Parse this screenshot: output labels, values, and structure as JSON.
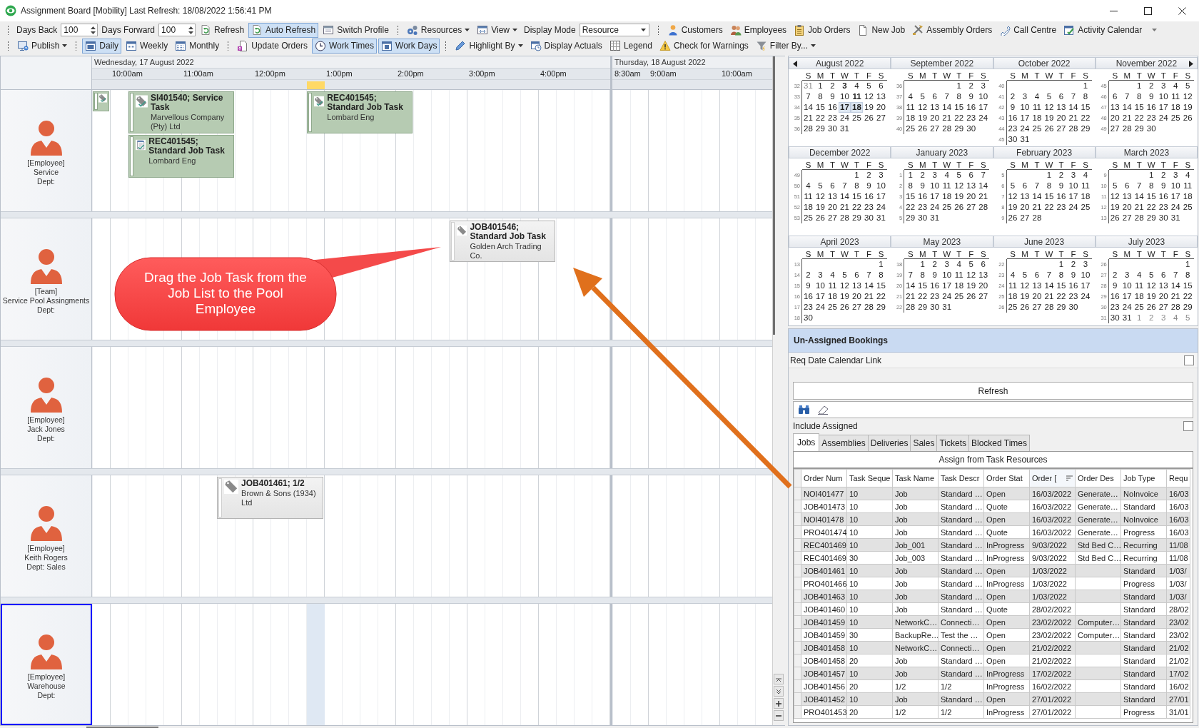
{
  "window": {
    "title": "Assignment Board [Mobility] Last Refresh: 18/08/2022 1:56:41 PM"
  },
  "toolbar": {
    "rows": [
      {
        "items": [
          {
            "kind": "grip"
          },
          {
            "kind": "label",
            "text": "Days Back"
          },
          {
            "kind": "spin",
            "value": "100"
          },
          {
            "kind": "label",
            "text": "Days Forward"
          },
          {
            "kind": "spin",
            "value": "100"
          },
          {
            "kind": "button",
            "label": "Refresh",
            "pressed": false
          },
          {
            "kind": "button",
            "label": "Auto Refresh",
            "pressed": true
          },
          {
            "kind": "button",
            "label": "Switch Profile",
            "pressed": false
          },
          {
            "kind": "grip"
          },
          {
            "kind": "menu",
            "label": "Resources",
            "pressed": false
          },
          {
            "kind": "menu",
            "label": "View",
            "pressed": false
          },
          {
            "kind": "label",
            "text": "Display Mode"
          },
          {
            "kind": "combo",
            "value": "Resource"
          },
          {
            "kind": "grip"
          },
          {
            "kind": "button",
            "label": "Customers",
            "pressed": false
          },
          {
            "kind": "button",
            "label": "Employees",
            "pressed": false
          },
          {
            "kind": "button",
            "label": "Job Orders",
            "pressed": false
          },
          {
            "kind": "button",
            "label": "New Job",
            "pressed": false
          },
          {
            "kind": "button",
            "label": "Assembly Orders",
            "pressed": false
          },
          {
            "kind": "button",
            "label": "Call Centre",
            "pressed": false
          },
          {
            "kind": "button",
            "label": "Activity Calendar",
            "pressed": false
          },
          {
            "kind": "overflow"
          }
        ]
      },
      {
        "items": [
          {
            "kind": "grip"
          },
          {
            "kind": "menu",
            "label": "Publish",
            "pressed": false
          },
          {
            "kind": "grip"
          },
          {
            "kind": "button",
            "label": "Daily",
            "pressed": true
          },
          {
            "kind": "button",
            "label": "Weekly",
            "pressed": false
          },
          {
            "kind": "button",
            "label": "Monthly",
            "pressed": false
          },
          {
            "kind": "grip"
          },
          {
            "kind": "button",
            "label": "Update Orders",
            "pressed": false
          },
          {
            "kind": "button",
            "label": "Work Times",
            "pressed": true
          },
          {
            "kind": "button",
            "label": "Work Days",
            "pressed": true
          },
          {
            "kind": "grip"
          },
          {
            "kind": "menu",
            "label": "Highlight By",
            "pressed": false
          },
          {
            "kind": "button",
            "label": "Display Actuals",
            "pressed": false
          },
          {
            "kind": "button",
            "label": "Legend",
            "pressed": false
          },
          {
            "kind": "button",
            "label": "Check for Warnings",
            "pressed": false
          },
          {
            "kind": "menu",
            "label": "Filter By...",
            "pressed": false
          }
        ]
      }
    ]
  },
  "schedule": {
    "days": [
      {
        "label": "Wednesday, 17 August 2022",
        "hours": [
          "10:00am",
          "11:00am",
          "12:00pm",
          "1:00pm",
          "2:00pm",
          "3:00pm",
          "4:00pm"
        ]
      },
      {
        "label": "Thursday, 18 August 2022",
        "hours": [
          "8:30am",
          "9:00am",
          "10:00am"
        ]
      }
    ],
    "resources": [
      {
        "type": "[Employee]",
        "name": "Service",
        "dept": "Dept:",
        "selected": false,
        "bookings": [
          {
            "assigned": true
          },
          {
            "title": "SI401540; Service Task",
            "customer": "Marvellous Company (Pty) Ltd",
            "assigned": true
          },
          {
            "title": "REC401545; Standard Job Task",
            "customer": "Lombard Eng",
            "assigned": true
          },
          {
            "title": "REC401545; Standard Job Task",
            "customer": "Lombard Eng",
            "assigned": true
          }
        ]
      },
      {
        "type": "[Team]",
        "name": "Service Pool Assingments",
        "dept": "Dept:",
        "selected": false,
        "bookings": [
          {
            "title": "JOB401546; Standard Job Task",
            "customer": "Golden Arch Trading Co.",
            "assigned": false
          }
        ]
      },
      {
        "type": "[Employee]",
        "name": "Jack Jones",
        "dept": "Dept:",
        "selected": false
      },
      {
        "type": "[Employee]",
        "name": "Keith Rogers",
        "dept": "Dept: Sales",
        "selected": false,
        "bookings": [
          {
            "title": "JOB401461; 1/2",
            "customer": "Brown & Sons (1934) Ltd",
            "assigned": false
          }
        ]
      },
      {
        "type": "[Employee]",
        "name": "Warehouse",
        "dept": "Dept:",
        "selected": true
      }
    ]
  },
  "calendar": {
    "months": [
      {
        "title": "August 2022",
        "weekdays": [
          "S",
          "M",
          "T",
          "W",
          "T",
          "F",
          "S"
        ],
        "weeks": [
          {
            "no": "32",
            "days": [
              {
                "day": "31",
                "other_month": true,
                "bold": false,
                "selected": false
              },
              "1",
              "2",
              {
                "day": "3",
                "other_month": false,
                "bold": true,
                "selected": false
              },
              "4",
              "5",
              "6"
            ]
          },
          {
            "no": "33",
            "days": [
              "7",
              "8",
              "9",
              "10",
              {
                "day": "11",
                "other_month": false,
                "bold": true,
                "selected": false
              },
              "12",
              "13"
            ]
          },
          {
            "no": "34",
            "days": [
              "14",
              "15",
              "16",
              {
                "day": "17",
                "other_month": false,
                "bold": true,
                "selected": true
              },
              {
                "day": "18",
                "other_month": false,
                "bold": true,
                "selected": true
              },
              "19",
              "20"
            ]
          },
          {
            "no": "35",
            "days": [
              "21",
              "22",
              "23",
              "24",
              "25",
              "26",
              "27"
            ]
          },
          {
            "no": "36",
            "days": [
              "28",
              "29",
              "30",
              "31"
            ]
          }
        ]
      },
      {
        "title": "September 2022",
        "weekdays": [
          "S",
          "M",
          "T",
          "W",
          "T",
          "F",
          "S"
        ],
        "weeks": [
          {
            "no": "36",
            "days": [
              "1",
              "2",
              "3"
            ]
          },
          {
            "no": "37",
            "days": [
              "4",
              "5",
              "6",
              "7",
              "8",
              "9",
              "10"
            ]
          },
          {
            "no": "38",
            "days": [
              "11",
              "12",
              "13",
              "14",
              "15",
              "16",
              "17"
            ]
          },
          {
            "no": "39",
            "days": [
              "18",
              "19",
              "20",
              "21",
              "22",
              "23",
              "24"
            ]
          },
          {
            "no": "40",
            "days": [
              "25",
              "26",
              "27",
              "28",
              "29",
              "30"
            ]
          }
        ]
      },
      {
        "title": "October 2022",
        "weekdays": [
          "S",
          "M",
          "T",
          "W",
          "T",
          "F",
          "S"
        ],
        "weeks": [
          {
            "no": "40",
            "days": [
              "1"
            ]
          },
          {
            "no": "41",
            "days": [
              "2",
              "3",
              "4",
              "5",
              "6",
              "7",
              "8"
            ]
          },
          {
            "no": "42",
            "days": [
              "9",
              "10",
              "11",
              "12",
              "13",
              "14",
              "15"
            ]
          },
          {
            "no": "43",
            "days": [
              "16",
              "17",
              "18",
              "19",
              "20",
              "21",
              "22"
            ]
          },
          {
            "no": "44",
            "days": [
              "23",
              "24",
              "25",
              "26",
              "27",
              "28",
              "29"
            ]
          },
          {
            "no": "45",
            "days": [
              "30",
              "31"
            ]
          }
        ]
      },
      {
        "title": "November 2022",
        "weekdays": [
          "S",
          "M",
          "T",
          "W",
          "T",
          "F",
          "S"
        ],
        "weeks": [
          {
            "no": "45",
            "days": [
              "1",
              "2",
              "3",
              "4",
              "5"
            ]
          },
          {
            "no": "46",
            "days": [
              "6",
              "7",
              "8",
              "9",
              "10",
              "11",
              "12"
            ]
          },
          {
            "no": "47",
            "days": [
              "13",
              "14",
              "15",
              "16",
              "17",
              "18",
              "19"
            ]
          },
          {
            "no": "48",
            "days": [
              "20",
              "21",
              "22",
              "23",
              "24",
              "25",
              "26"
            ]
          },
          {
            "no": "49",
            "days": [
              "27",
              "28",
              "29",
              "30"
            ]
          }
        ]
      },
      {
        "title": "December 2022",
        "weekdays": [
          "S",
          "M",
          "T",
          "W",
          "T",
          "F",
          "S"
        ],
        "weeks": [
          {
            "no": "49",
            "days": [
              "1",
              "2",
              "3"
            ]
          },
          {
            "no": "50",
            "days": [
              "4",
              "5",
              "6",
              "7",
              "8",
              "9",
              "10"
            ]
          },
          {
            "no": "51",
            "days": [
              "11",
              "12",
              "13",
              "14",
              "15",
              "16",
              "17"
            ]
          },
          {
            "no": "52",
            "days": [
              "18",
              "19",
              "20",
              "21",
              "22",
              "23",
              "24"
            ]
          },
          {
            "no": "53",
            "days": [
              "25",
              "26",
              "27",
              "28",
              "29",
              "30",
              "31"
            ]
          }
        ]
      },
      {
        "title": "January 2023",
        "weekdays": [
          "S",
          "M",
          "T",
          "W",
          "T",
          "F",
          "S"
        ],
        "weeks": [
          {
            "no": "1",
            "days": [
              "1",
              "2",
              "3",
              "4",
              "5",
              "6",
              "7"
            ]
          },
          {
            "no": "2",
            "days": [
              "8",
              "9",
              "10",
              "11",
              "12",
              "13",
              "14"
            ]
          },
          {
            "no": "3",
            "days": [
              "15",
              "16",
              "17",
              "18",
              "19",
              "20",
              "21"
            ]
          },
          {
            "no": "4",
            "days": [
              "22",
              "23",
              "24",
              "25",
              "26",
              "27",
              "28"
            ]
          },
          {
            "no": "5",
            "days": [
              "29",
              "30",
              "31"
            ]
          }
        ]
      },
      {
        "title": "February 2023",
        "weekdays": [
          "S",
          "M",
          "T",
          "W",
          "T",
          "F",
          "S"
        ],
        "weeks": [
          {
            "no": "5",
            "days": [
              "1",
              "2",
              "3",
              "4"
            ]
          },
          {
            "no": "6",
            "days": [
              "5",
              "6",
              "7",
              "8",
              "9",
              "10",
              "11"
            ]
          },
          {
            "no": "7",
            "days": [
              "12",
              "13",
              "14",
              "15",
              "16",
              "17",
              "18"
            ]
          },
          {
            "no": "8",
            "days": [
              "19",
              "20",
              "21",
              "22",
              "23",
              "24",
              "25"
            ]
          },
          {
            "no": "9",
            "days": [
              "26",
              "27",
              "28"
            ]
          }
        ]
      },
      {
        "title": "March 2023",
        "weekdays": [
          "S",
          "M",
          "T",
          "W",
          "T",
          "F",
          "S"
        ],
        "weeks": [
          {
            "no": "9",
            "days": [
              "1",
              "2",
              "3",
              "4"
            ]
          },
          {
            "no": "10",
            "days": [
              "5",
              "6",
              "7",
              "8",
              "9",
              "10",
              "11"
            ]
          },
          {
            "no": "11",
            "days": [
              "12",
              "13",
              "14",
              "15",
              "16",
              "17",
              "18"
            ]
          },
          {
            "no": "12",
            "days": [
              "19",
              "20",
              "21",
              "22",
              "23",
              "24",
              "25"
            ]
          },
          {
            "no": "13",
            "days": [
              "26",
              "27",
              "28",
              "29",
              "30",
              "31"
            ]
          }
        ]
      },
      {
        "title": "April 2023",
        "weekdays": [
          "S",
          "M",
          "T",
          "W",
          "T",
          "F",
          "S"
        ],
        "weeks": [
          {
            "no": "13",
            "days": [
              "1"
            ]
          },
          {
            "no": "14",
            "days": [
              "2",
              "3",
              "4",
              "5",
              "6",
              "7",
              "8"
            ]
          },
          {
            "no": "15",
            "days": [
              "9",
              "10",
              "11",
              "12",
              "13",
              "14",
              "15"
            ]
          },
          {
            "no": "16",
            "days": [
              "16",
              "17",
              "18",
              "19",
              "20",
              "21",
              "22"
            ]
          },
          {
            "no": "17",
            "days": [
              "23",
              "24",
              "25",
              "26",
              "27",
              "28",
              "29"
            ]
          },
          {
            "no": "18",
            "days": [
              "30"
            ]
          }
        ]
      },
      {
        "title": "May 2023",
        "weekdays": [
          "S",
          "M",
          "T",
          "W",
          "T",
          "F",
          "S"
        ],
        "weeks": [
          {
            "no": "18",
            "days": [
              "1",
              "2",
              "3",
              "4",
              "5",
              "6"
            ]
          },
          {
            "no": "19",
            "days": [
              "7",
              "8",
              "9",
              "10",
              "11",
              "12",
              "13"
            ]
          },
          {
            "no": "20",
            "days": [
              "14",
              "15",
              "16",
              "17",
              "18",
              "19",
              "20"
            ]
          },
          {
            "no": "21",
            "days": [
              "21",
              "22",
              "23",
              "24",
              "25",
              "26",
              "27"
            ]
          },
          {
            "no": "22",
            "days": [
              "28",
              "29",
              "30",
              "31"
            ]
          }
        ]
      },
      {
        "title": "June 2023",
        "weekdays": [
          "S",
          "M",
          "T",
          "W",
          "T",
          "F",
          "S"
        ],
        "weeks": [
          {
            "no": "22",
            "days": [
              "1",
              "2",
              "3"
            ]
          },
          {
            "no": "23",
            "days": [
              "4",
              "5",
              "6",
              "7",
              "8",
              "9",
              "10"
            ]
          },
          {
            "no": "24",
            "days": [
              "11",
              "12",
              "13",
              "14",
              "15",
              "16",
              "17"
            ]
          },
          {
            "no": "25",
            "days": [
              "18",
              "19",
              "20",
              "21",
              "22",
              "23",
              "24"
            ]
          },
          {
            "no": "26",
            "days": [
              "25",
              "26",
              "27",
              "28",
              "29",
              "30"
            ]
          }
        ]
      },
      {
        "title": "July 2023",
        "weekdays": [
          "S",
          "M",
          "T",
          "W",
          "T",
          "F",
          "S"
        ],
        "weeks": [
          {
            "no": "26",
            "days": [
              "1"
            ]
          },
          {
            "no": "27",
            "days": [
              "2",
              "3",
              "4",
              "5",
              "6",
              "7",
              "8"
            ]
          },
          {
            "no": "28",
            "days": [
              "9",
              "10",
              "11",
              "12",
              "13",
              "14",
              "15"
            ]
          },
          {
            "no": "29",
            "days": [
              "16",
              "17",
              "18",
              "19",
              "20",
              "21",
              "22"
            ]
          },
          {
            "no": "30",
            "days": [
              "23",
              "24",
              "25",
              "26",
              "27",
              "28",
              "29"
            ]
          },
          {
            "no": "31",
            "days": [
              "30",
              "31",
              {
                "day": "1",
                "other_month": true,
                "bold": false,
                "selected": false
              },
              {
                "day": "2",
                "other_month": true,
                "bold": false,
                "selected": false
              },
              {
                "day": "3",
                "other_month": true,
                "bold": false,
                "selected": false
              },
              {
                "day": "4",
                "other_month": true,
                "bold": false,
                "selected": false
              },
              {
                "day": "5",
                "other_month": true,
                "bold": false,
                "selected": false
              }
            ]
          }
        ]
      }
    ]
  },
  "unassigned": {
    "title": "Un-Assigned Bookings",
    "calendar_link": {
      "label": "Req Date Calendar Link",
      "checked": false
    },
    "refresh": "Refresh",
    "include_assigned": {
      "label": "Include Assigned",
      "checked": false
    },
    "tabs": [
      {
        "label": "Jobs",
        "selected": true
      },
      {
        "label": "Assemblies",
        "selected": false
      },
      {
        "label": "Deliveries",
        "selected": false
      },
      {
        "label": "Sales",
        "selected": false
      },
      {
        "label": "Tickets",
        "selected": false
      },
      {
        "label": "Blocked Times",
        "selected": false
      }
    ],
    "assign_button": "Assign from Task Resources",
    "columns": [
      {
        "label": "Order Num",
        "sorted": false
      },
      {
        "label": "Task Seque",
        "sorted": false
      },
      {
        "label": "Task Name",
        "sorted": false
      },
      {
        "label": "Task Descr",
        "sorted": false
      },
      {
        "label": "Order Stat",
        "sorted": false
      },
      {
        "label": "Order [",
        "sorted": true
      },
      {
        "label": "Order Des",
        "sorted": false
      },
      {
        "label": "Job Type",
        "sorted": false
      },
      {
        "label": "Requ",
        "sorted": false
      }
    ],
    "rows": [
      [
        "NOI401477",
        "10",
        "Job",
        "Standard …",
        "Open",
        "16/03/2022",
        "Generate…",
        "NoInvoice",
        "16/03"
      ],
      [
        "JOB401473",
        "10",
        "Job",
        "Standard …",
        "Quote",
        "16/03/2022",
        "Generate…",
        "Standard",
        "16/03"
      ],
      [
        "NOI401478",
        "10",
        "Job",
        "Standard …",
        "Open",
        "16/03/2022",
        "Generate…",
        "NoInvoice",
        "16/03"
      ],
      [
        "PRO401474",
        "10",
        "Job",
        "Standard …",
        "Quote",
        "16/03/2022",
        "Generate…",
        "Progress",
        "16/03"
      ],
      [
        "REC401469",
        "10",
        "Job_001",
        "Standard …",
        "InProgress",
        "9/03/2022",
        "Std Bed C…",
        "Recurring",
        "11/08"
      ],
      [
        "REC401469",
        "30",
        "Job_003",
        "Standard …",
        "InProgress",
        "9/03/2022",
        "Std Bed C…",
        "Recurring",
        "11/08"
      ],
      [
        "JOB401461",
        "10",
        "Job",
        "Standard …",
        "Open",
        "1/03/2022",
        null,
        "Standard",
        "1/03/"
      ],
      [
        "PRO401466",
        "10",
        "Job",
        "Standard …",
        "InProgress",
        "1/03/2022",
        null,
        "Progress",
        "1/03/"
      ],
      [
        "JOB401463",
        "10",
        "Job",
        "Standard …",
        "Open",
        "1/03/2022",
        null,
        "Standard",
        "1/03/"
      ],
      [
        "JOB401460",
        "10",
        "Job",
        "Standard …",
        "Quote",
        "28/02/2022",
        null,
        "Standard",
        "28/02"
      ],
      [
        "JOB401459",
        "10",
        "NetworkC…",
        "Connecti…",
        "Open",
        "23/02/2022",
        "Computer…",
        "Standard",
        "23/02"
      ],
      [
        "JOB401459",
        "30",
        "BackupRe…",
        "Test the …",
        "Open",
        "23/02/2022",
        "Computer…",
        "Standard",
        "23/02"
      ],
      [
        "JOB401458",
        "10",
        "NetworkC…",
        "Connecti…",
        "Open",
        "21/02/2022",
        null,
        "Standard",
        "21/02"
      ],
      [
        "JOB401458",
        "20",
        "Job",
        "Standard …",
        "Open",
        "21/02/2022",
        null,
        "Standard",
        "21/02"
      ],
      [
        "JOB401457",
        "10",
        "Job",
        "Standard …",
        "InProgress",
        "17/02/2022",
        null,
        "Standard",
        "17/02"
      ],
      [
        "JOB401456",
        "20",
        "1/2",
        "1/2",
        "InProgress",
        "16/02/2022",
        null,
        "Standard",
        "16/02"
      ],
      [
        "JOB401452",
        "10",
        "Job",
        "Standard …",
        "Open",
        "27/01/2022",
        null,
        "Standard",
        "27/01"
      ],
      [
        "PRO401453",
        "20",
        "1/2",
        "1/2",
        "InProgress",
        "27/01/2022",
        null,
        "Progress",
        "31/01"
      ]
    ]
  },
  "annotation": {
    "text": "Drag the Job Task from the Job List to the Pool Employee"
  }
}
